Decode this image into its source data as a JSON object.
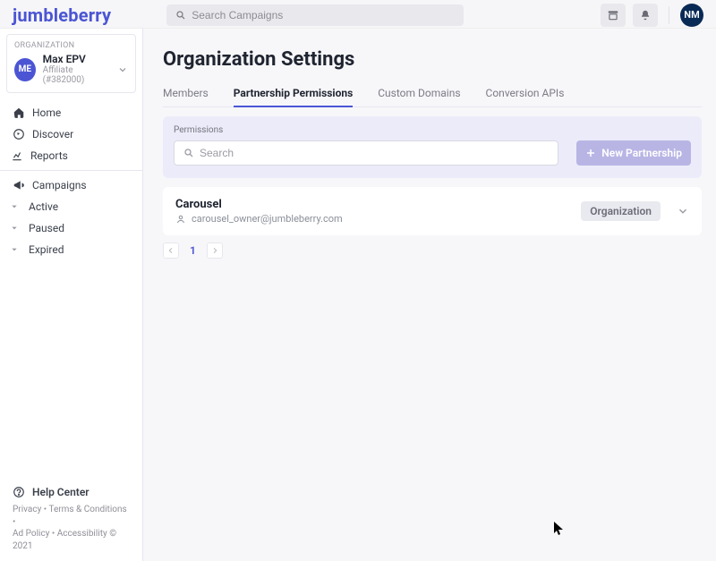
{
  "brand": "jumbleberry",
  "top_avatar": "NM",
  "search": {
    "placeholder": "Search Campaigns"
  },
  "org_card": {
    "label": "ORGANIZATION",
    "avatar": "ME",
    "name": "Max EPV",
    "sub": "Affiliate (#382000)"
  },
  "sidebar": {
    "nav": {
      "home": "Home",
      "discover": "Discover",
      "reports": "Reports",
      "campaigns": "Campaigns",
      "active": "Active",
      "paused": "Paused",
      "expired": "Expired"
    },
    "help": "Help Center",
    "legal": {
      "privacy": "Privacy",
      "terms": "Terms & Conditions",
      "adpolicy": "Ad Policy",
      "accessibility": "Accessibility",
      "copyright": "© 2021",
      "dot": " • "
    }
  },
  "page": {
    "title": "Organization Settings"
  },
  "tabs": {
    "members": "Members",
    "partnership_permissions": "Partnership Permissions",
    "custom_domains": "Custom Domains",
    "conversion_apis": "Conversion APIs"
  },
  "permissions": {
    "label": "Permissions",
    "search_placeholder": "Search",
    "new_btn": "New Partnership"
  },
  "cards": [
    {
      "title": "Carousel",
      "email": "carousel_owner@jumbleberry.com",
      "role": "Organization"
    }
  ],
  "pager": {
    "current": "1"
  }
}
